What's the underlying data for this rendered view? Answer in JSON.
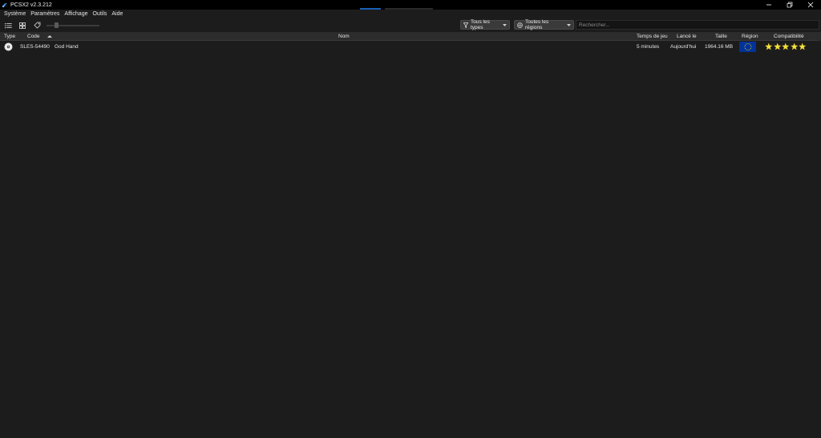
{
  "window": {
    "title": "PCSX2 v2.3.212",
    "app_icon": "pcsx2-logo-icon",
    "controls": [
      "minimize-icon",
      "restore-icon",
      "close-icon"
    ]
  },
  "menu": {
    "items": [
      {
        "label": "Système"
      },
      {
        "label": "Paramètres"
      },
      {
        "label": "Affichage"
      },
      {
        "label": "Outils"
      },
      {
        "label": "Aide"
      }
    ]
  },
  "toolbar": {
    "list_view_icon": "list-view-icon",
    "grid_view_icon": "grid-view-icon",
    "tag_icon": "tag-icon",
    "zoom_slider_level": 0.2,
    "type_filter": {
      "icon": "filter-icon",
      "label": "Tous les types"
    },
    "region_filter": {
      "icon": "globe-icon",
      "label": "Toutes les régions"
    },
    "search": {
      "placeholder": "Rechercher...",
      "value": ""
    }
  },
  "table": {
    "columns": {
      "type": "Type",
      "code": "Code",
      "name": "Nom",
      "playtime": "Temps de jeu",
      "last_played": "Lancé le",
      "size": "Taille",
      "region": "Région",
      "compatibility": "Compatibilité"
    },
    "sort": {
      "column": "Code",
      "direction": "ascending"
    },
    "rows": [
      {
        "type_icon": "disc-icon",
        "code": "SLES-54490",
        "name": "God Hand",
        "playtime": "5 minutes",
        "last_played": "Aujourd'hui",
        "size": "1964.16 MB",
        "region_flag": "eu-flag-icon",
        "compatibility_stars": 5
      }
    ]
  },
  "colors": {
    "background": "#1c1c1c",
    "titlebar": "#000000",
    "header": "#2c2c2c",
    "star": "#f5e03a",
    "eu_flag": "#003399"
  }
}
